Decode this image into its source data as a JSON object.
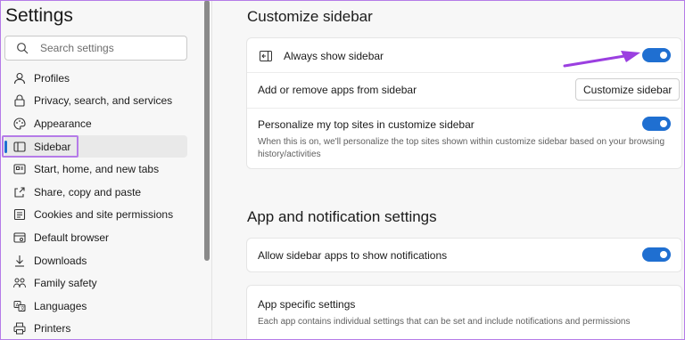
{
  "nav": {
    "title": "Settings",
    "search_placeholder": "Search settings",
    "items": [
      {
        "label": "Profiles",
        "icon": "profile-icon"
      },
      {
        "label": "Privacy, search, and services",
        "icon": "lock-icon"
      },
      {
        "label": "Appearance",
        "icon": "palette-icon"
      },
      {
        "label": "Sidebar",
        "icon": "sidebar-icon",
        "active": true
      },
      {
        "label": "Start, home, and new tabs",
        "icon": "home-icon"
      },
      {
        "label": "Share, copy and paste",
        "icon": "share-icon"
      },
      {
        "label": "Cookies and site permissions",
        "icon": "cookies-icon"
      },
      {
        "label": "Default browser",
        "icon": "browser-icon"
      },
      {
        "label": "Downloads",
        "icon": "download-icon"
      },
      {
        "label": "Family safety",
        "icon": "family-icon"
      },
      {
        "label": "Languages",
        "icon": "languages-icon"
      },
      {
        "label": "Printers",
        "icon": "printer-icon"
      }
    ]
  },
  "customize": {
    "heading": "Customize sidebar",
    "always_show": {
      "label": "Always show sidebar",
      "on": true
    },
    "add_remove": {
      "label": "Add or remove apps from sidebar",
      "button": "Customize sidebar"
    },
    "personalize": {
      "label": "Personalize my top sites in customize sidebar",
      "desc_line1": "When this is on, we'll personalize the top sites shown within customize sidebar based on your browsing",
      "desc_line2": "history/activities",
      "on": true
    }
  },
  "notifications": {
    "heading": "App and notification settings",
    "allow": {
      "label": "Allow sidebar apps to show notifications",
      "on": true
    },
    "app_specific": {
      "label": "App specific settings",
      "desc": "Each app contains individual settings that can be set and include notifications and permissions"
    }
  },
  "colors": {
    "accent": "#1f6fd1",
    "highlight": "#b57be8",
    "arrow": "#9b3fe0"
  }
}
